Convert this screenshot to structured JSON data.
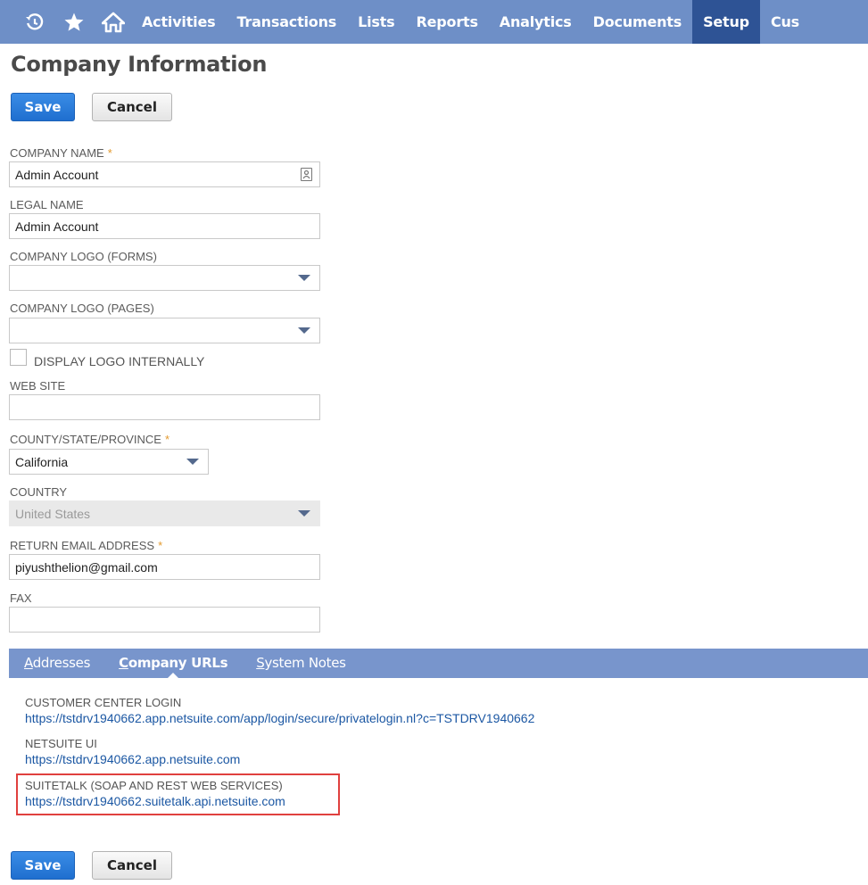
{
  "nav": {
    "items": [
      {
        "label": "Activities",
        "active": false
      },
      {
        "label": "Transactions",
        "active": false
      },
      {
        "label": "Lists",
        "active": false
      },
      {
        "label": "Reports",
        "active": false
      },
      {
        "label": "Analytics",
        "active": false
      },
      {
        "label": "Documents",
        "active": false
      },
      {
        "label": "Setup",
        "active": true
      },
      {
        "label": "Cus",
        "active": false
      }
    ],
    "icons": [
      "recent-records-icon",
      "favorites-star-icon",
      "home-icon"
    ],
    "bar_color": "#6e8fc7",
    "active_color": "#2e5395"
  },
  "page": {
    "title": "Company Information"
  },
  "buttons": {
    "save": "Save",
    "cancel": "Cancel"
  },
  "form": {
    "company_name": {
      "label": "COMPANY NAME",
      "required": "*",
      "value": "Admin Account"
    },
    "legal_name": {
      "label": "LEGAL NAME",
      "value": "Admin Account"
    },
    "logo_forms": {
      "label": "COMPANY LOGO (FORMS)",
      "value": ""
    },
    "logo_pages": {
      "label": "COMPANY LOGO (PAGES)",
      "value": ""
    },
    "display_logo": {
      "label": "DISPLAY LOGO INTERNALLY",
      "checked": false
    },
    "web_site": {
      "label": "WEB SITE",
      "value": ""
    },
    "state": {
      "label": "COUNTY/STATE/PROVINCE",
      "required": "*",
      "value": "California"
    },
    "country": {
      "label": "COUNTRY",
      "value": "United States"
    },
    "return_email": {
      "label": "RETURN EMAIL ADDRESS",
      "required": "*",
      "value": "piyushthelion@gmail.com"
    },
    "fax": {
      "label": "FAX",
      "value": ""
    }
  },
  "tabs": [
    {
      "first": "A",
      "rest": "ddresses",
      "active": false
    },
    {
      "first": "C",
      "rest": "ompany URLs",
      "active": true
    },
    {
      "first": "S",
      "rest": "ystem Notes",
      "active": false
    }
  ],
  "urls": {
    "customer_center": {
      "label": "CUSTOMER CENTER LOGIN",
      "url": "https://tstdrv1940662.app.netsuite.com/app/login/secure/privatelogin.nl?c=TSTDRV1940662"
    },
    "netsuite_ui": {
      "label": "NETSUITE UI",
      "url": "https://tstdrv1940662.app.netsuite.com"
    },
    "suitetalk": {
      "label": "SUITETALK (SOAP AND REST WEB SERVICES)",
      "url": "https://tstdrv1940662.suitetalk.api.netsuite.com"
    }
  },
  "colors": {
    "accent": "#2d7bd8",
    "required": "#e39a2f",
    "link": "#1b57a3",
    "highlight": "#e0403e"
  }
}
